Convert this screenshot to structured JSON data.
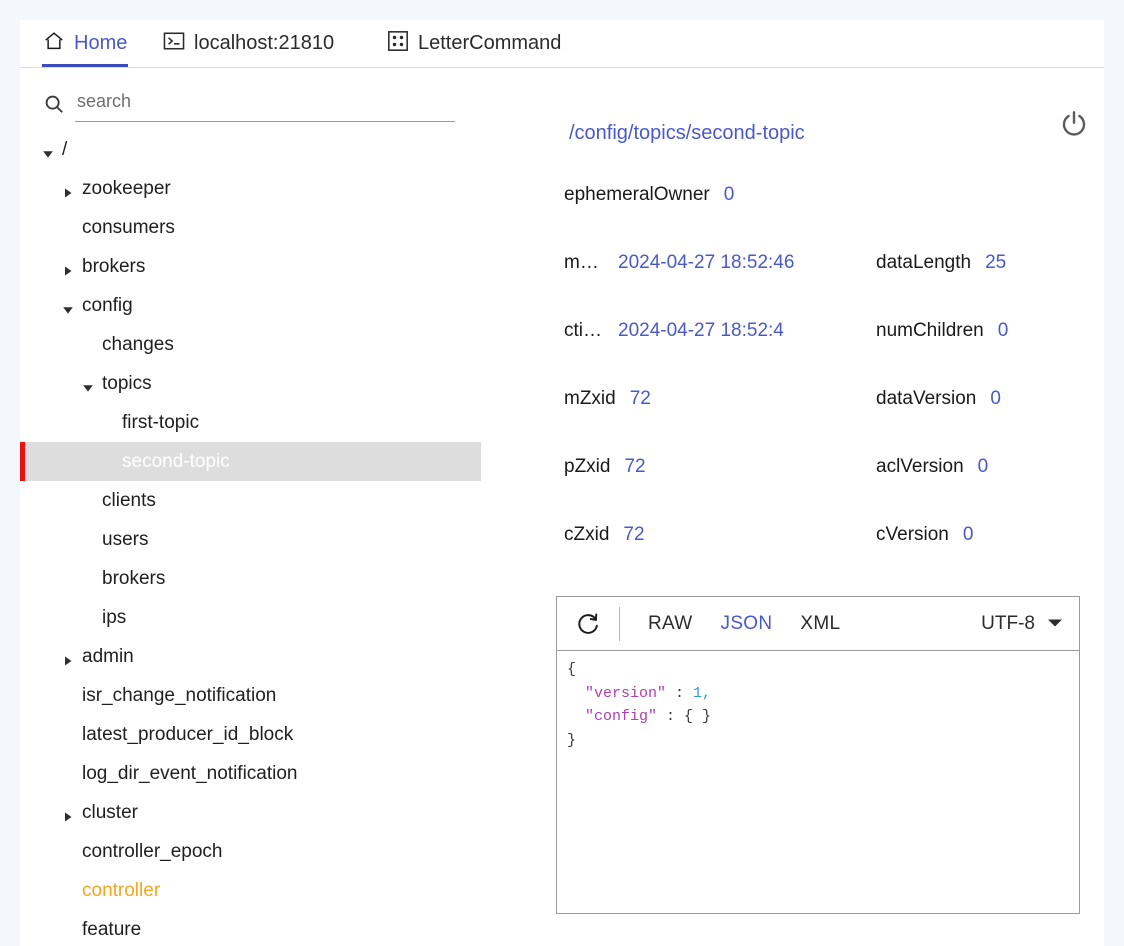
{
  "tabs": [
    {
      "id": "home",
      "label": "Home",
      "icon": "home-icon",
      "active": true
    },
    {
      "id": "localhost",
      "label": "localhost:21810",
      "icon": "terminal-icon",
      "active": false
    },
    {
      "id": "letter",
      "label": "LetterCommand",
      "icon": "dice-icon",
      "active": false
    }
  ],
  "search": {
    "placeholder": "search",
    "value": "",
    "icon": "search-icon"
  },
  "tree": {
    "items": [
      {
        "label": "/",
        "depth": 0,
        "arrow": "down",
        "state": "normal"
      },
      {
        "label": "zookeeper",
        "depth": 1,
        "arrow": "right",
        "state": "normal"
      },
      {
        "label": "consumers",
        "depth": 1,
        "arrow": "none",
        "state": "normal"
      },
      {
        "label": "brokers",
        "depth": 1,
        "arrow": "right",
        "state": "normal"
      },
      {
        "label": "config",
        "depth": 1,
        "arrow": "down",
        "state": "normal"
      },
      {
        "label": "changes",
        "depth": 2,
        "arrow": "none",
        "state": "normal"
      },
      {
        "label": "topics",
        "depth": 2,
        "arrow": "down",
        "state": "normal"
      },
      {
        "label": "first-topic",
        "depth": 3,
        "arrow": "none",
        "state": "normal"
      },
      {
        "label": "second-topic",
        "depth": 3,
        "arrow": "none",
        "state": "selected"
      },
      {
        "label": "clients",
        "depth": 2,
        "arrow": "none",
        "state": "normal"
      },
      {
        "label": "users",
        "depth": 2,
        "arrow": "none",
        "state": "normal"
      },
      {
        "label": "brokers",
        "depth": 2,
        "arrow": "none",
        "state": "normal"
      },
      {
        "label": "ips",
        "depth": 2,
        "arrow": "none",
        "state": "normal"
      },
      {
        "label": "admin",
        "depth": 1,
        "arrow": "right",
        "state": "normal"
      },
      {
        "label": "isr_change_notification",
        "depth": 1,
        "arrow": "none",
        "state": "normal"
      },
      {
        "label": "latest_producer_id_block",
        "depth": 1,
        "arrow": "none",
        "state": "normal"
      },
      {
        "label": "log_dir_event_notification",
        "depth": 1,
        "arrow": "none",
        "state": "normal"
      },
      {
        "label": "cluster",
        "depth": 1,
        "arrow": "right",
        "state": "normal"
      },
      {
        "label": "controller_epoch",
        "depth": 1,
        "arrow": "none",
        "state": "normal"
      },
      {
        "label": "controller",
        "depth": 1,
        "arrow": "none",
        "state": "highlight"
      },
      {
        "label": "feature",
        "depth": 1,
        "arrow": "none",
        "state": "normal"
      }
    ]
  },
  "detail": {
    "path": "/config/topics/second-topic",
    "power_icon": "power-icon",
    "meta_rows": [
      [
        {
          "key": "ephemeralOwner",
          "value": "0"
        },
        null
      ],
      [
        {
          "key": "mtime",
          "value": "2024-04-27 18:52:46",
          "truncated": true
        },
        {
          "key": "dataLength",
          "value": "25"
        }
      ],
      [
        {
          "key": "ctime",
          "value": "2024-04-27 18:52:4",
          "truncated": true
        },
        {
          "key": "numChildren",
          "value": "0"
        }
      ],
      [
        {
          "key": "mZxid",
          "value": "72"
        },
        {
          "key": "dataVersion",
          "value": "0"
        }
      ],
      [
        {
          "key": "pZxid",
          "value": "72"
        },
        {
          "key": "aclVersion",
          "value": "0"
        }
      ],
      [
        {
          "key": "cZxid",
          "value": "72"
        },
        {
          "key": "cVersion",
          "value": "0"
        }
      ]
    ]
  },
  "viewer": {
    "refresh_icon": "refresh-icon",
    "formats": [
      {
        "label": "RAW",
        "active": false
      },
      {
        "label": "JSON",
        "active": true
      },
      {
        "label": "XML",
        "active": false
      }
    ],
    "encoding": "UTF-8",
    "encoding_caret": "chevron-down-icon",
    "content_lines": [
      {
        "text": "{",
        "type": "punc"
      },
      {
        "key": "\"version\"",
        "sep": " : ",
        "value": "1,",
        "valtype": "num",
        "indent": 2
      },
      {
        "key": "\"config\"",
        "sep": " : ",
        "value": "{ }",
        "valtype": "punc",
        "indent": 2
      },
      {
        "text": "}",
        "type": "punc"
      }
    ]
  },
  "colors": {
    "accent": "#4a59c9",
    "selection_bar": "#ee1111",
    "selection_bg": "#dddddd",
    "highlight": "#f5a623",
    "json_key": "#b040b0",
    "json_num": "#30a0c8"
  }
}
